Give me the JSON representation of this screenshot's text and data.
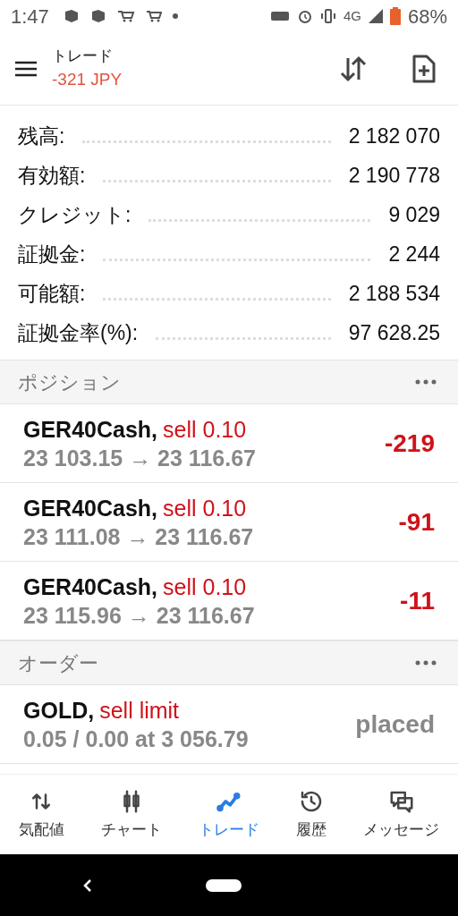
{
  "status_bar": {
    "time": "1:47",
    "network": "4G",
    "battery": "68%"
  },
  "header": {
    "title": "トレード",
    "profit": "-321 JPY"
  },
  "account": [
    {
      "label": "残高:",
      "value": "2 182 070"
    },
    {
      "label": "有効額:",
      "value": "2 190 778"
    },
    {
      "label": "クレジット:",
      "value": "9 029"
    },
    {
      "label": "証拠金:",
      "value": "2 244"
    },
    {
      "label": "可能額:",
      "value": "2 188 534"
    },
    {
      "label": "証拠金率(%):",
      "value": "97 628.25"
    }
  ],
  "positions": {
    "title": "ポジション",
    "items": [
      {
        "symbol": "GER40Cash,",
        "side": "sell 0.10",
        "prices": "23 103.15 → 23 116.67",
        "profit": "-219"
      },
      {
        "symbol": "GER40Cash,",
        "side": "sell 0.10",
        "prices": "23 111.08 → 23 116.67",
        "profit": "-91"
      },
      {
        "symbol": "GER40Cash,",
        "side": "sell 0.10",
        "prices": "23 115.96 → 23 116.67",
        "profit": "-11"
      }
    ]
  },
  "orders": {
    "title": "オーダー",
    "items": [
      {
        "symbol": "GOLD,",
        "side": "sell limit",
        "details": "0.05 / 0.00 at 3 056.79",
        "state": "placed"
      }
    ]
  },
  "bottom_nav": [
    {
      "kind": "quotes",
      "label": "気配値",
      "selected": false
    },
    {
      "kind": "chart",
      "label": "チャート",
      "selected": false
    },
    {
      "kind": "trade",
      "label": "トレード",
      "selected": true
    },
    {
      "kind": "history",
      "label": "履歴",
      "selected": false
    },
    {
      "kind": "messages",
      "label": "メッセージ",
      "selected": false
    }
  ]
}
